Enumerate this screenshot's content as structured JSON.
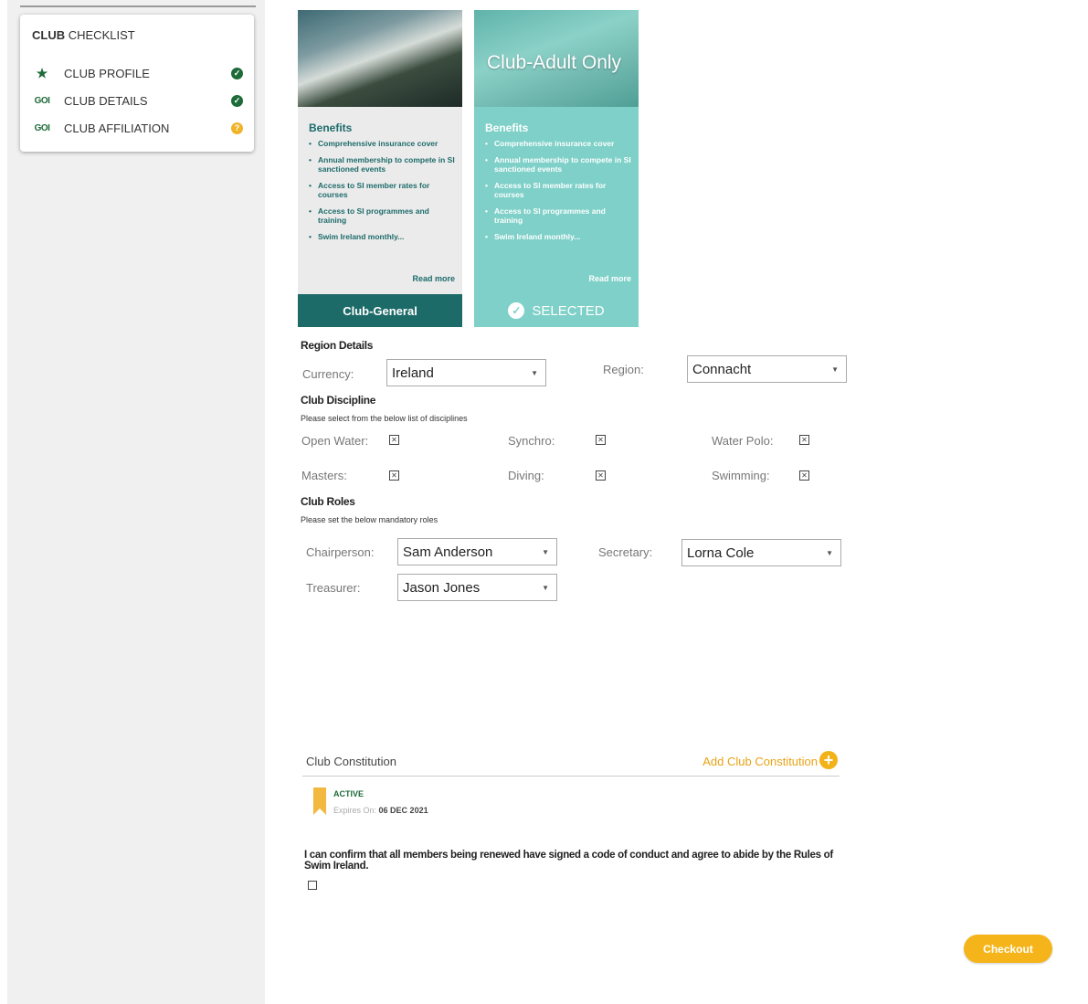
{
  "checklist": {
    "title_bold": "CLUB",
    "title_rest": "CHECKLIST",
    "items": [
      {
        "label": "CLUB PROFILE",
        "lead_icon": "star-icon",
        "status": "complete"
      },
      {
        "label": "CLUB DETAILS",
        "lead_icon": "goi-icon",
        "status": "complete"
      },
      {
        "label": "CLUB AFFILIATION",
        "lead_icon": "goi-icon",
        "status": "pending"
      }
    ]
  },
  "memberships": [
    {
      "name": "Club-General",
      "caption": "",
      "benefits_title": "Benefits",
      "benefits": [
        "Comprehensive insurance cover",
        "Annual membership to compete in SI sanctioned events",
        "Access to SI member rates for courses",
        "Access to SI programmes and training",
        "Swim Ireland monthly..."
      ],
      "read_more": "Read more",
      "button_label": "Club-General",
      "selected": false
    },
    {
      "name": "Club-Adult Only",
      "caption": "Club-Adult Only",
      "benefits_title": "Benefits",
      "benefits": [
        "Comprehensive insurance cover",
        "Annual membership to compete in SI sanctioned events",
        "Access to SI member rates for courses",
        "Access to SI programmes and training",
        "Swim Ireland monthly..."
      ],
      "read_more": "Read more",
      "button_label": "SELECTED",
      "selected": true
    }
  ],
  "region": {
    "section_title": "Region Details",
    "currency_label": "Currency:",
    "currency_value": "Ireland",
    "region_label": "Region:",
    "region_value": "Connacht"
  },
  "discipline": {
    "section_title": "Club Discipline",
    "hint": "Please select from the below list of disciplines",
    "items": [
      {
        "label": "Open Water:"
      },
      {
        "label": "Synchro:"
      },
      {
        "label": "Water Polo:"
      },
      {
        "label": "Masters:"
      },
      {
        "label": "Diving:"
      },
      {
        "label": "Swimming:"
      }
    ]
  },
  "roles": {
    "section_title": "Club Roles",
    "hint": "Please set the below mandatory roles",
    "chairperson_label": "Chairperson:",
    "chairperson_value": "Sam Anderson",
    "secretary_label": "Secretary:",
    "secretary_value": "Lorna Cole",
    "treasurer_label": "Treasurer:",
    "treasurer_value": "Jason Jones"
  },
  "constitution": {
    "title": "Club Constitution",
    "add_label": "Add Club Constitution",
    "status": "ACTIVE",
    "expires_label": "Expires On:",
    "expires_date": "06 DEC 2021"
  },
  "confirm_text": "I can confirm that all members being renewed have signed a code of conduct and agree to abide by the Rules of Swim Ireland.",
  "checkout_label": "Checkout",
  "colors": {
    "brand_green": "#1e6b3a",
    "teal_dark": "#1d6b68",
    "teal_light": "#7ed0c8",
    "accent_orange": "#f5b51a"
  }
}
